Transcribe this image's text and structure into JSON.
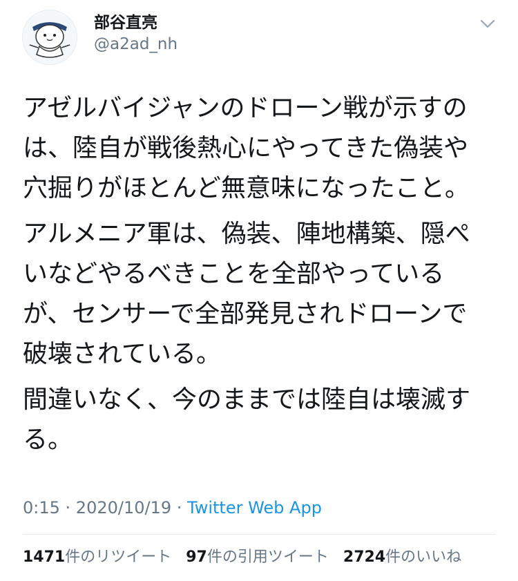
{
  "user": {
    "display_name": "部谷直亮",
    "handle": "@a2ad_nh",
    "avatar_icon": "cartoon-character-avatar"
  },
  "menu_icon": "chevron-down-icon",
  "tweet": {
    "paragraphs": [
      "アゼルバイジャンのドローン戦が示すの\nは、陸自が戦後熱心にやってきた偽装や\n穴掘りがほとんど無意味になったこと。",
      "アルメニア軍は、偽装、陣地構築、隠ぺ\nいなどやるべきことを全部やっている\nが、センサーで全部発見されドローンで\n破壊されている。",
      "間違いなく、今のままでは陸自は壊滅す\nる。"
    ]
  },
  "meta": {
    "time": "0:15",
    "separator1": " · ",
    "date": "2020/10/19",
    "separator2": " · ",
    "source": "Twitter Web App"
  },
  "stats": {
    "retweets": {
      "count": "1471",
      "label": "件のリツイート"
    },
    "quotes": {
      "count": "97",
      "label": "件の引用ツイート"
    },
    "likes": {
      "count": "2724",
      "label": "件のいいね"
    }
  },
  "colors": {
    "text": "#14171a",
    "secondary": "#657786",
    "link": "#1b95e0",
    "divider": "#e6ecf0"
  }
}
